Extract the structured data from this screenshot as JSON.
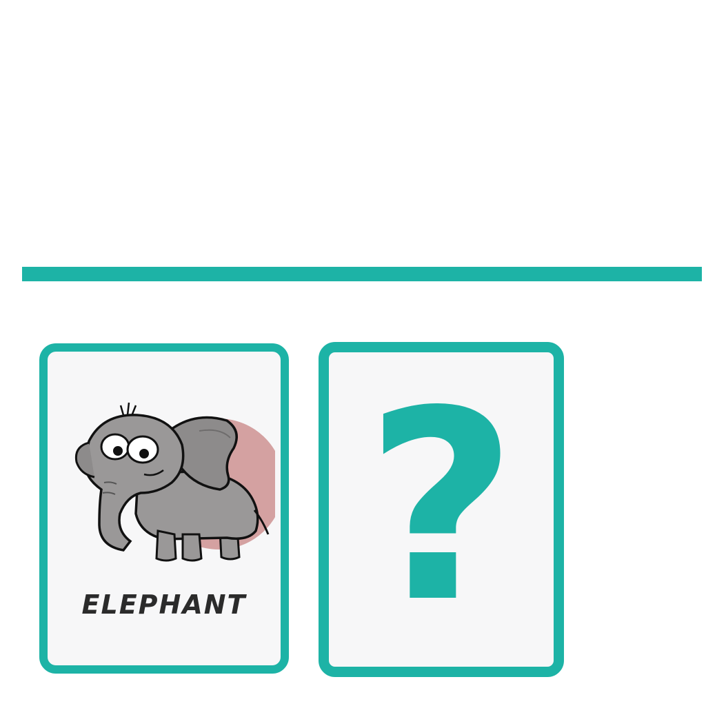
{
  "colors": {
    "accent": "#1db3a6",
    "card_background": "#f7f7f8",
    "sun_circle": "#d4a1a1",
    "elephant_gray": "#9a9898"
  },
  "cards": [
    {
      "label": "ELEPHANT",
      "icon": "elephant-icon",
      "face": "revealed"
    },
    {
      "symbol": "?",
      "icon": "question-mark-icon",
      "face": "hidden"
    }
  ]
}
